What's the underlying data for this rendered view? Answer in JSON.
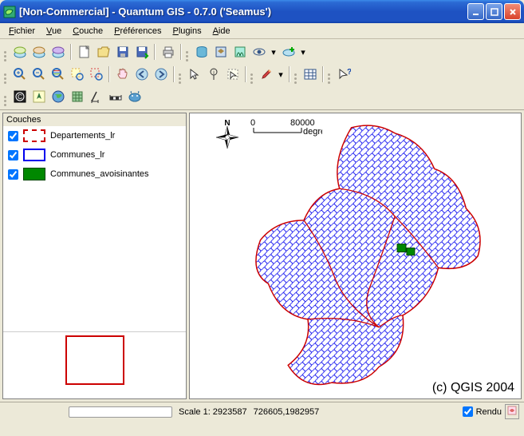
{
  "title": "[Non-Commercial] - Quantum GIS - 0.7.0 ('Seamus')",
  "menu": {
    "file": "Fichier",
    "view": "Vue",
    "layer": "Couche",
    "prefs": "Préférences",
    "plugins": "Plugins",
    "help": "Aide"
  },
  "panel": {
    "layers_title": "Couches",
    "items": [
      {
        "label": "Departements_lr",
        "checked": true
      },
      {
        "label": "Communes_lr",
        "checked": true
      },
      {
        "label": "Communes_avoisinantes",
        "checked": true
      }
    ]
  },
  "scale_label": "80000",
  "scale_unit": "degrés",
  "north_label": "N",
  "copyright": "(c) QGIS 2004",
  "status": {
    "scale": "Scale 1: 2923587",
    "coords": "726605,1982957",
    "render_label": "Rendu",
    "render_checked": true
  },
  "colors": {
    "titlebar": "#1e52c2",
    "deps": "#cc0000",
    "communes": "#0000ee",
    "avois": "#008800"
  }
}
